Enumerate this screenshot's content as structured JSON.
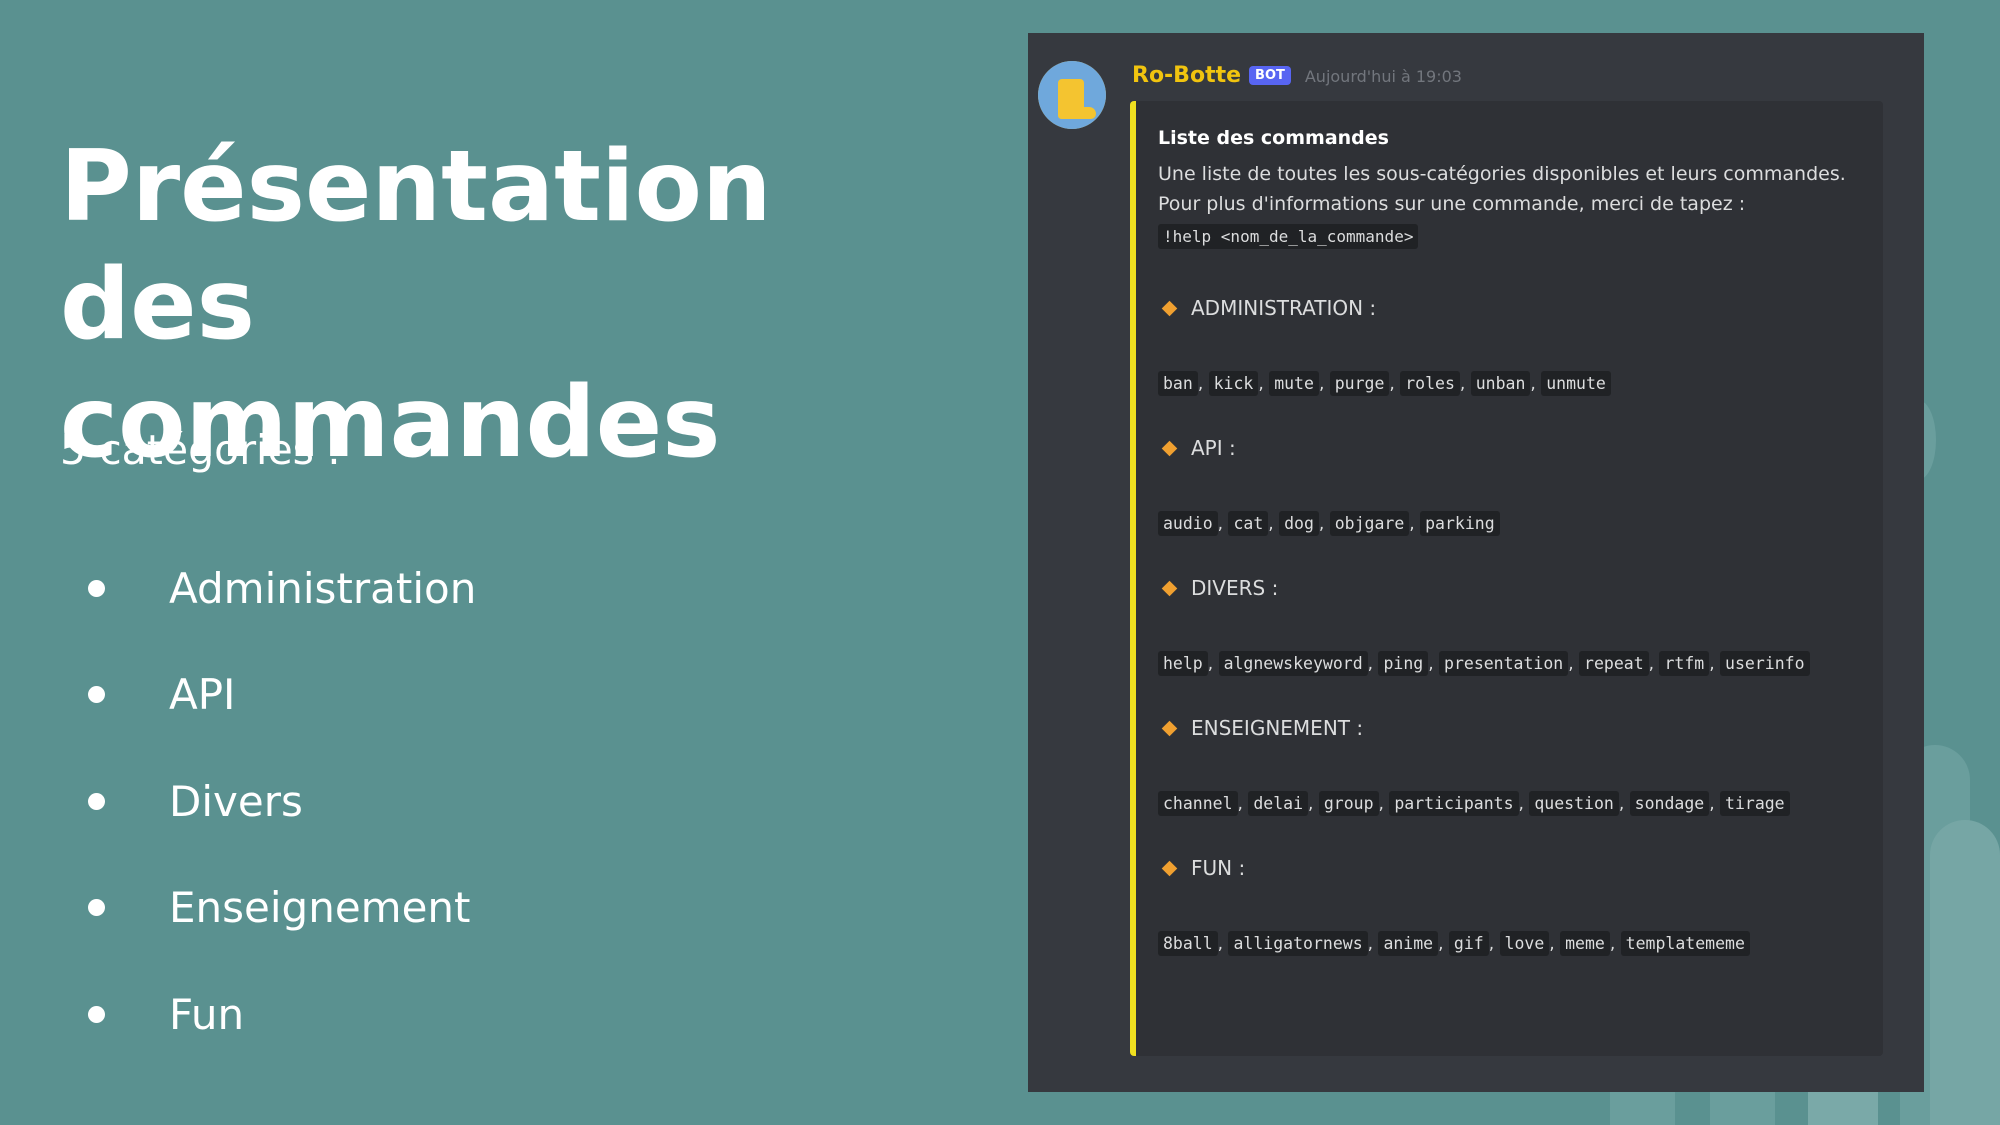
{
  "slide": {
    "title_line1": "Présentation des",
    "title_line2": "commandes",
    "subtitle": "5 catégories :",
    "categories": [
      "Administration",
      "API",
      "Divers",
      "Enseignement",
      "Fun"
    ]
  },
  "message": {
    "username": "Ro-Botte",
    "bot_tag": "BOT",
    "timestamp": "Aujourd'hui à 19:03",
    "embed": {
      "accent_color": "#f0e020",
      "title": "Liste des commandes",
      "desc_line1": "Une liste de toutes les sous-catégories disponibles et leurs commandes.",
      "desc_line2": "Pour plus d'informations sur une commande, merci de tapez :",
      "help_cmd": "!help <nom_de_la_commande>",
      "sections": [
        {
          "name": "ADMINISTRATION :",
          "commands": [
            "ban",
            "kick",
            "mute",
            "purge",
            "roles",
            "unban",
            "unmute"
          ]
        },
        {
          "name": "API :",
          "commands": [
            "audio",
            "cat",
            "dog",
            "objgare",
            "parking"
          ]
        },
        {
          "name": "DIVERS :",
          "commands": [
            "help",
            "algnewskeyword",
            "ping",
            "presentation",
            "repeat",
            "rtfm",
            "userinfo"
          ]
        },
        {
          "name": "ENSEIGNEMENT :",
          "commands": [
            "channel",
            "delai",
            "group",
            "participants",
            "question",
            "sondage",
            "tirage"
          ]
        },
        {
          "name": "FUN :",
          "commands": [
            "8ball",
            "alligatornews",
            "anime",
            "gif",
            "love",
            "meme",
            "templatememe"
          ]
        }
      ]
    }
  },
  "colors": {
    "background": "#5a9190",
    "discord_bg": "#36393f",
    "embed_bg": "#2f3136",
    "username": "#f1c40f",
    "diamond": "#f0a030"
  }
}
